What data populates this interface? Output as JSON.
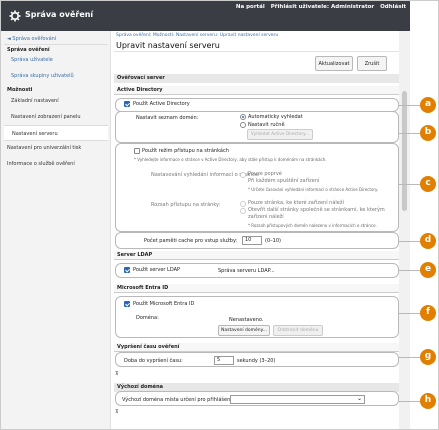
{
  "header": {
    "app_title": "Správa ověření",
    "links": [
      "Na portál",
      "Přihlásit uživatele: Administrator",
      "Odhlásit"
    ]
  },
  "sidebar": {
    "back": "◄ Správa ověřování",
    "group1": "Správa ověření",
    "items1": [
      "Správa uživatele",
      "Správa skupiny uživatelů"
    ],
    "group2": "Možnosti",
    "items2": [
      "Základní nastavení",
      "Nastavení zobrazení panelu",
      "Nastavení serveru",
      "Nastavení pro univerzální tisk",
      "Informace o službě ověření"
    ]
  },
  "main": {
    "breadcrumb": "Správa ověření: Možnosti: Nastavení serveru: Upravit nastavení serveru",
    "title": "Upravit nastavení serveru",
    "update_label": "Aktualizovat",
    "cancel_label": "Zrušit",
    "sec_auth": "Ověřovací server",
    "sub_ad": "Active Directory",
    "use_ad": "Použít Active Directory",
    "domain_list_label": "Nastavit seznam domén:",
    "radio_auto": "Automaticky vyhledat",
    "radio_manual": "Nastavit ručně",
    "search_ad_btn": "Vyhledat Active Directory...",
    "use_site_mode": "Použít režim přístupu na stránkách",
    "site_note": "* Vyhledejte informace o stránce v Active Directory, aby stále přístup k doménám na stránkách.",
    "site_info_label": "Nastavování vyhledání informací o stránce:",
    "site_info_opt1": "Pouze poprvé",
    "site_info_opt2": "Při každém spuštění zařízení",
    "site_info_note": "* Určete časování vyhledání informací o stránce Active Directory.",
    "site_range_label": "Rozsah přístupu na stránky:",
    "site_range_opt1": "Pouze stránka, ke které zařízení náleží",
    "site_range_opt2a": "Otevřít další stránky společně se stránkami, ke kterým",
    "site_range_opt2b": "zařízení náleží",
    "site_range_note": "* Rozsah přístupových domén nalezeno v informacích o stránce.",
    "cache_label": "Počet paměti cache pro vstup služby:",
    "cache_value": "10",
    "cache_range": "(0–10)",
    "sub_ldap": "Server LDAP",
    "use_ldap": "Použít server LDAP",
    "ldap_manage": "Správa serveru LDAP...",
    "sub_entra": "Microsoft Entra ID",
    "use_entra": "Použít Microsoft Entra ID",
    "domain_label": "Doména:",
    "domain_status": "Nenastaveno.",
    "domain_settings_btn": "Nastavení domény...",
    "domain_delete_btn": "Odstranit doménu",
    "sub_timeout": "Vypršení času ověření",
    "timeout_label": "Doba do vypršení času:",
    "timeout_value": "5",
    "timeout_unit": "sekundy (3–20)",
    "sec_default": "Výchozí doména",
    "default_label": "Výchozí doména místa určení pro přihlášení:",
    "collapse_mark": "⊼"
  },
  "callouts": [
    "a",
    "b",
    "c",
    "d",
    "e",
    "f",
    "g",
    "h"
  ],
  "colors": {
    "accent": "#e07f00",
    "topbar": "#3a3d44",
    "link": "#3a6ea5",
    "check": "#2a67b3"
  }
}
